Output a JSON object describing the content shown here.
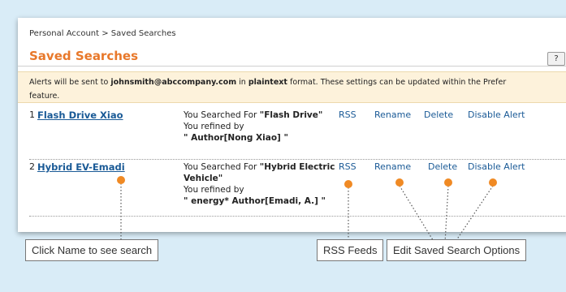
{
  "breadcrumb": "Personal Account > Saved Searches",
  "page_title": "Saved Searches",
  "help_label": "?",
  "alert": {
    "prefix": "Alerts will be sent to ",
    "email": "johnsmith@abccompany.com",
    "middle": " in ",
    "format": "plaintext",
    "suffix": " format. These settings can be updated within the Prefer",
    "line2": "feature."
  },
  "searches": [
    {
      "number": "1",
      "name": "Flash Drive Xiao",
      "searched_label": "You Searched For ",
      "query": "\"Flash Drive\"",
      "refined_label": "You refined by",
      "refinement": "\" Author[Nong Xiao] \""
    },
    {
      "number": "2",
      "name": "Hybrid EV-Emadi",
      "searched_label": "You Searched For ",
      "query_line1": "\"Hybrid Electric",
      "query_line2": "Vehicle\"",
      "refined_label": "You refined by",
      "refinement": "\" energy* Author[Emadi, A.] \""
    }
  ],
  "actions": {
    "rss": "RSS",
    "rename": "Rename",
    "delete": "Delete",
    "disable_alert": "Disable Alert"
  },
  "callouts": {
    "name": "Click Name to see search",
    "rss": "RSS Feeds",
    "options": "Edit Saved Search Options"
  },
  "colors": {
    "title": "#e8782a",
    "link": "#1a5a96",
    "alert_bg": "#fdf2db",
    "marker": "#f08a24",
    "background": "#d9ecf7"
  }
}
